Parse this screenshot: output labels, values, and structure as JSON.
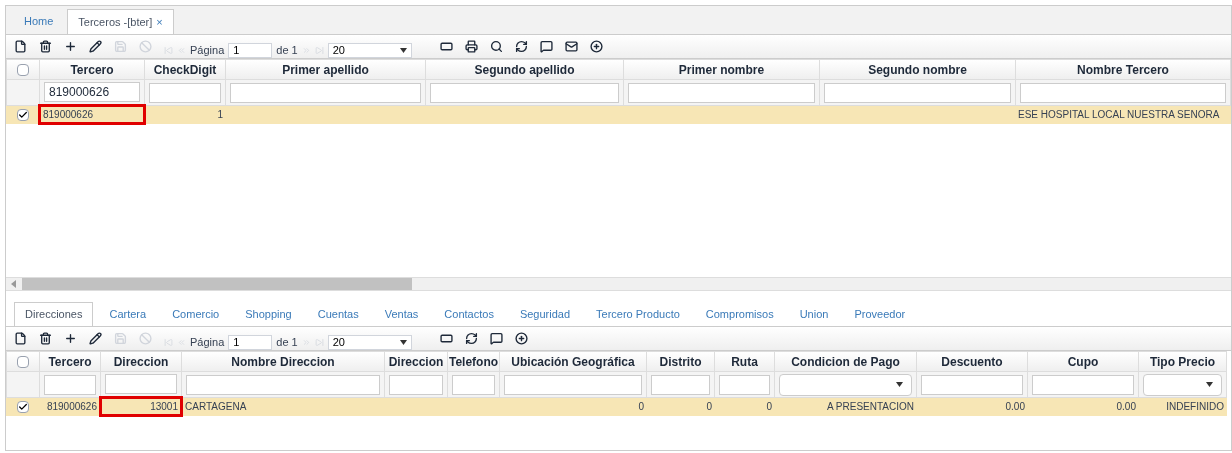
{
  "tabs": [
    {
      "label": "Home",
      "selected": false
    },
    {
      "label": "Terceros -[bter]",
      "close": "×",
      "selected": true
    }
  ],
  "main_grid": {
    "pager": {
      "label": "Página",
      "page": "1",
      "of": "de 1",
      "page_size": "20"
    },
    "header_checked": false,
    "columns": [
      "Tercero",
      "CheckDigit",
      "Primer apellido",
      "Segundo apellido",
      "Primer nombre",
      "Segundo nombre",
      "Nombre Tercero"
    ],
    "filters": [
      {
        "kind": "text",
        "value": "819000626"
      },
      {
        "kind": "text"
      },
      {
        "kind": "text"
      },
      {
        "kind": "text"
      },
      {
        "kind": "text"
      },
      {
        "kind": "text"
      },
      {
        "kind": "text"
      }
    ],
    "rows": [
      {
        "checked": true,
        "cells": [
          {
            "text": "819000626",
            "highlighted": true
          },
          {
            "text": "1",
            "highlighted": false
          },
          {
            "highlighted": false
          },
          {
            "highlighted": false
          },
          {
            "highlighted": false
          },
          {
            "highlighted": false
          },
          {
            "text": "ESE HOSPITAL LOCAL NUESTRA SENORA",
            "highlighted": false
          }
        ]
      }
    ]
  },
  "detail_tabs": [
    {
      "label": "Direcciones",
      "selected": true
    },
    {
      "label": "Cartera",
      "selected": false
    },
    {
      "label": "Comercio",
      "selected": false
    },
    {
      "label": "Shopping",
      "selected": false
    },
    {
      "label": "Cuentas",
      "selected": false
    },
    {
      "label": "Ventas",
      "selected": false
    },
    {
      "label": "Contactos",
      "selected": false
    },
    {
      "label": "Seguridad",
      "selected": false
    },
    {
      "label": "Tercero Producto",
      "selected": false
    },
    {
      "label": "Compromisos",
      "selected": false
    },
    {
      "label": "Union",
      "selected": false
    },
    {
      "label": "Proveedor",
      "selected": false
    }
  ],
  "detail_grid": {
    "pager": {
      "label": "Página",
      "page": "1",
      "of": "de 1",
      "page_size": "20"
    },
    "header_checked": false,
    "columns": [
      "Tercero",
      "Direccion",
      "Nombre Direccion",
      "Direccion",
      "Telefono",
      "Ubicación Geográfica",
      "Distrito",
      "Ruta",
      "Condicion de Pago",
      "Descuento",
      "Cupo",
      "Tipo Precio"
    ],
    "filters": [
      {
        "kind": "text"
      },
      {
        "kind": "text"
      },
      {
        "kind": "text"
      },
      {
        "kind": "text"
      },
      {
        "kind": "text"
      },
      {
        "kind": "text"
      },
      {
        "kind": "text"
      },
      {
        "kind": "text"
      },
      {
        "kind": "select"
      },
      {
        "kind": "text"
      },
      {
        "kind": "text"
      },
      {
        "kind": "select"
      }
    ],
    "rows": [
      {
        "checked": true,
        "cells": [
          {
            "text": "819000626",
            "highlighted": false
          },
          {
            "text": "13001",
            "highlighted": true
          },
          {
            "text": "CARTAGENA",
            "highlighted": false
          },
          {
            "highlighted": false
          },
          {
            "highlighted": false
          },
          {
            "text": "0",
            "highlighted": false
          },
          {
            "text": "0",
            "highlighted": false
          },
          {
            "text": "0",
            "highlighted": false
          },
          {
            "text": "A PRESENTACION",
            "highlighted": false
          },
          {
            "text": "0.00",
            "highlighted": false
          },
          {
            "text": "0.00",
            "highlighted": false
          },
          {
            "text": "INDEFINIDO",
            "highlighted": false
          }
        ]
      }
    ]
  }
}
